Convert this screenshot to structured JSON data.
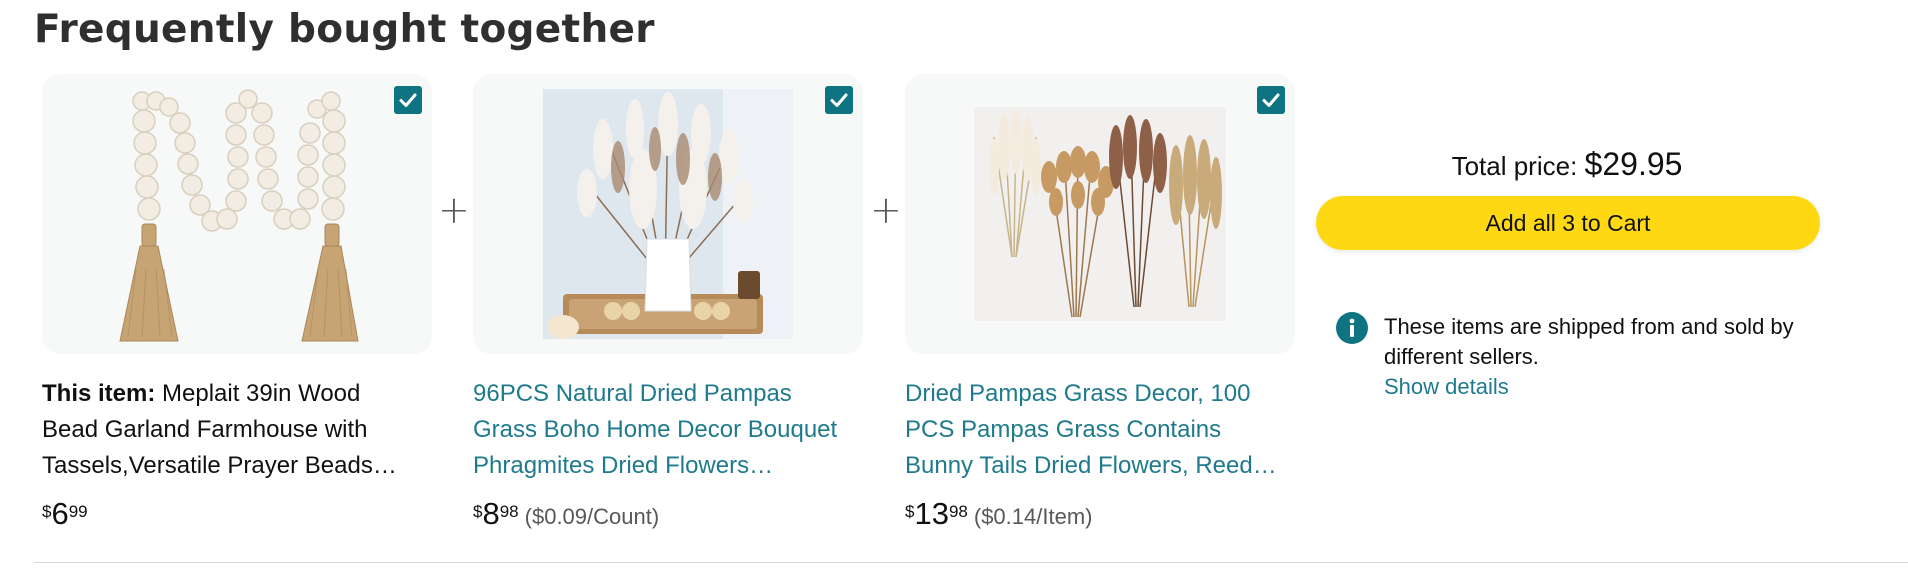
{
  "section": {
    "title": "Frequently bought together"
  },
  "items": [
    {
      "checked": true,
      "label_prefix": "This item:",
      "title_lines": [
        "Meplait 39in Wood",
        "Bead Garland Farmhouse with",
        "Tassels,Versatile Prayer Beads…"
      ],
      "price_currency": "$",
      "price_whole": "6",
      "price_fraction": "99",
      "unit_price": ""
    },
    {
      "checked": true,
      "label_prefix": "",
      "title_lines": [
        "96PCS Natural Dried Pampas",
        "Grass Boho Home Decor Bouquet",
        "Phragmites Dried Flowers…"
      ],
      "price_currency": "$",
      "price_whole": "8",
      "price_fraction": "98",
      "unit_price": "($0.09/Count)"
    },
    {
      "checked": true,
      "label_prefix": "",
      "title_lines": [
        "Dried Pampas Grass Decor, 100",
        "PCS Pampas Grass Contains",
        "Bunny Tails Dried Flowers, Reed…"
      ],
      "price_currency": "$",
      "price_whole": "13",
      "price_fraction": "98",
      "unit_price": "($0.14/Item)"
    }
  ],
  "separator": "+",
  "summary": {
    "total_label": "Total price:",
    "total_value": "$29.95",
    "add_button_label": "Add all 3 to Cart",
    "seller_notice_line1": "These items are shipped from and sold by",
    "seller_notice_line2": "different sellers.",
    "show_details_label": "Show details"
  },
  "icons": {
    "checkbox": "checkbox-checked-icon",
    "info": "info-icon"
  },
  "colors": {
    "accent_teal": "#0f7482",
    "link": "#1e7a8c",
    "button_yellow": "#ffd814"
  }
}
